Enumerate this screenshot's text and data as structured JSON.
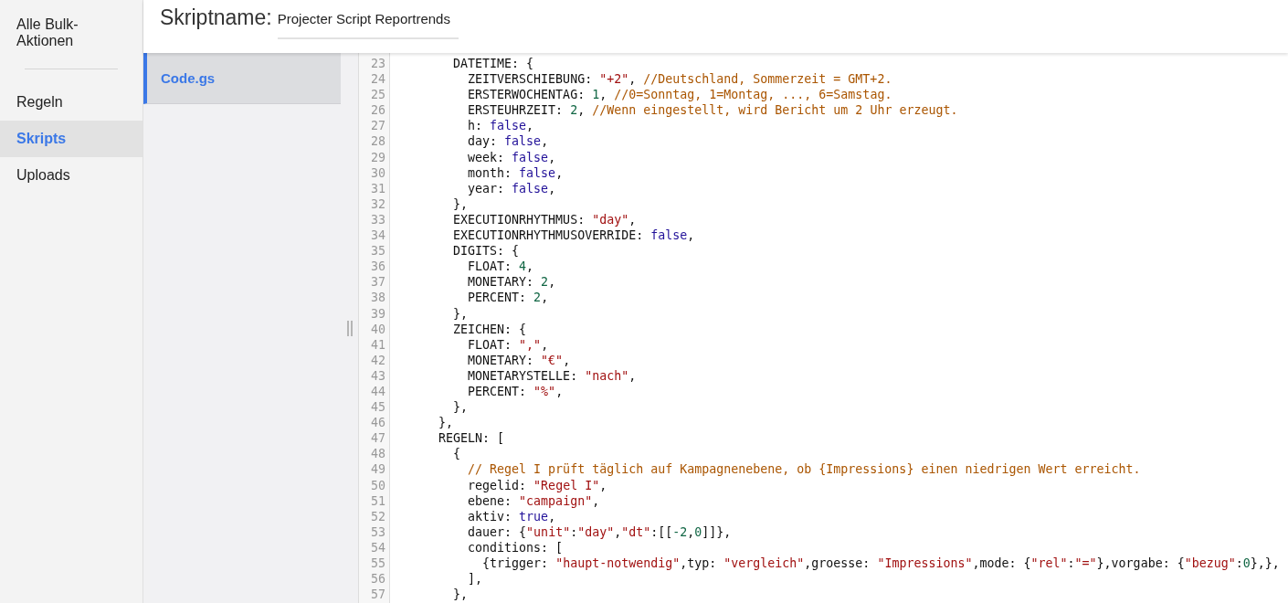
{
  "sidebar": {
    "groups": [
      [
        {
          "label": "Alle Bulk-Aktionen",
          "selected": false
        }
      ],
      [
        {
          "label": "Regeln",
          "selected": false
        },
        {
          "label": "Skripts",
          "selected": true
        },
        {
          "label": "Uploads",
          "selected": false
        }
      ]
    ]
  },
  "header": {
    "label": "Skriptname:",
    "value": "Projecter Script Reportrends"
  },
  "files": [
    {
      "name": "Code.gs",
      "selected": true
    }
  ],
  "editor": {
    "lines": [
      {
        "number": "23",
        "tokens": [
          {
            "kind": "plain",
            "text": "        DATETIME: {"
          }
        ]
      },
      {
        "number": "24",
        "tokens": [
          {
            "kind": "plain",
            "text": "          ZEITVERSCHIEBUNG: "
          },
          {
            "kind": "string",
            "text": "\"+2\""
          },
          {
            "kind": "plain",
            "text": ", "
          },
          {
            "kind": "comment",
            "text": "//Deutschland, Sommerzeit = GMT+2."
          }
        ]
      },
      {
        "number": "25",
        "tokens": [
          {
            "kind": "plain",
            "text": "          ERSTERWOCHENTAG: "
          },
          {
            "kind": "number",
            "text": "1"
          },
          {
            "kind": "plain",
            "text": ", "
          },
          {
            "kind": "comment",
            "text": "//0=Sonntag, 1=Montag, ..., 6=Samstag."
          }
        ]
      },
      {
        "number": "26",
        "tokens": [
          {
            "kind": "plain",
            "text": "          ERSTEUHRZEIT: "
          },
          {
            "kind": "number",
            "text": "2"
          },
          {
            "kind": "plain",
            "text": ", "
          },
          {
            "kind": "comment",
            "text": "//Wenn eingestellt, wird Bericht um 2 Uhr erzeugt."
          }
        ]
      },
      {
        "number": "27",
        "tokens": [
          {
            "kind": "plain",
            "text": "          h: "
          },
          {
            "kind": "keyword",
            "text": "false"
          },
          {
            "kind": "plain",
            "text": ","
          }
        ]
      },
      {
        "number": "28",
        "tokens": [
          {
            "kind": "plain",
            "text": "          day: "
          },
          {
            "kind": "keyword",
            "text": "false"
          },
          {
            "kind": "plain",
            "text": ","
          }
        ]
      },
      {
        "number": "29",
        "tokens": [
          {
            "kind": "plain",
            "text": "          week: "
          },
          {
            "kind": "keyword",
            "text": "false"
          },
          {
            "kind": "plain",
            "text": ","
          }
        ]
      },
      {
        "number": "30",
        "tokens": [
          {
            "kind": "plain",
            "text": "          month: "
          },
          {
            "kind": "keyword",
            "text": "false"
          },
          {
            "kind": "plain",
            "text": ","
          }
        ]
      },
      {
        "number": "31",
        "tokens": [
          {
            "kind": "plain",
            "text": "          year: "
          },
          {
            "kind": "keyword",
            "text": "false"
          },
          {
            "kind": "plain",
            "text": ","
          }
        ]
      },
      {
        "number": "32",
        "tokens": [
          {
            "kind": "plain",
            "text": "        },"
          }
        ]
      },
      {
        "number": "33",
        "tokens": [
          {
            "kind": "plain",
            "text": "        EXECUTIONRHYTHMUS: "
          },
          {
            "kind": "string",
            "text": "\"day\""
          },
          {
            "kind": "plain",
            "text": ","
          }
        ]
      },
      {
        "number": "34",
        "tokens": [
          {
            "kind": "plain",
            "text": "        EXECUTIONRHYTHMUSOVERRIDE: "
          },
          {
            "kind": "keyword",
            "text": "false"
          },
          {
            "kind": "plain",
            "text": ","
          }
        ]
      },
      {
        "number": "35",
        "tokens": [
          {
            "kind": "plain",
            "text": "        DIGITS: {"
          }
        ]
      },
      {
        "number": "36",
        "tokens": [
          {
            "kind": "plain",
            "text": "          FLOAT: "
          },
          {
            "kind": "number",
            "text": "4"
          },
          {
            "kind": "plain",
            "text": ","
          }
        ]
      },
      {
        "number": "37",
        "tokens": [
          {
            "kind": "plain",
            "text": "          MONETARY: "
          },
          {
            "kind": "number",
            "text": "2"
          },
          {
            "kind": "plain",
            "text": ","
          }
        ]
      },
      {
        "number": "38",
        "tokens": [
          {
            "kind": "plain",
            "text": "          PERCENT: "
          },
          {
            "kind": "number",
            "text": "2"
          },
          {
            "kind": "plain",
            "text": ","
          }
        ]
      },
      {
        "number": "39",
        "tokens": [
          {
            "kind": "plain",
            "text": "        },"
          }
        ]
      },
      {
        "number": "40",
        "tokens": [
          {
            "kind": "plain",
            "text": "        ZEICHEN: {"
          }
        ]
      },
      {
        "number": "41",
        "tokens": [
          {
            "kind": "plain",
            "text": "          FLOAT: "
          },
          {
            "kind": "string",
            "text": "\",\""
          },
          {
            "kind": "plain",
            "text": ","
          }
        ]
      },
      {
        "number": "42",
        "tokens": [
          {
            "kind": "plain",
            "text": "          MONETARY: "
          },
          {
            "kind": "string",
            "text": "\"€\""
          },
          {
            "kind": "plain",
            "text": ","
          }
        ]
      },
      {
        "number": "43",
        "tokens": [
          {
            "kind": "plain",
            "text": "          MONETARYSTELLE: "
          },
          {
            "kind": "string",
            "text": "\"nach\""
          },
          {
            "kind": "plain",
            "text": ","
          }
        ]
      },
      {
        "number": "44",
        "tokens": [
          {
            "kind": "plain",
            "text": "          PERCENT: "
          },
          {
            "kind": "string",
            "text": "\"%\""
          },
          {
            "kind": "plain",
            "text": ","
          }
        ]
      },
      {
        "number": "45",
        "tokens": [
          {
            "kind": "plain",
            "text": "        },"
          }
        ]
      },
      {
        "number": "46",
        "tokens": [
          {
            "kind": "plain",
            "text": "      },"
          }
        ]
      },
      {
        "number": "47",
        "tokens": [
          {
            "kind": "plain",
            "text": "      REGELN: ["
          }
        ]
      },
      {
        "number": "48",
        "tokens": [
          {
            "kind": "plain",
            "text": "        {"
          }
        ]
      },
      {
        "number": "49",
        "tokens": [
          {
            "kind": "comment",
            "text": "          // Regel I prüft täglich auf Kampagnenebene, ob {Impressions} einen niedrigen Wert erreicht."
          }
        ]
      },
      {
        "number": "50",
        "tokens": [
          {
            "kind": "plain",
            "text": "          regelid: "
          },
          {
            "kind": "string",
            "text": "\"Regel I\""
          },
          {
            "kind": "plain",
            "text": ","
          }
        ]
      },
      {
        "number": "51",
        "tokens": [
          {
            "kind": "plain",
            "text": "          ebene: "
          },
          {
            "kind": "string",
            "text": "\"campaign\""
          },
          {
            "kind": "plain",
            "text": ","
          }
        ]
      },
      {
        "number": "52",
        "tokens": [
          {
            "kind": "plain",
            "text": "          aktiv: "
          },
          {
            "kind": "keyword",
            "text": "true"
          },
          {
            "kind": "plain",
            "text": ","
          }
        ]
      },
      {
        "number": "53",
        "tokens": [
          {
            "kind": "plain",
            "text": "          dauer: {"
          },
          {
            "kind": "string",
            "text": "\"unit\""
          },
          {
            "kind": "plain",
            "text": ":"
          },
          {
            "kind": "string",
            "text": "\"day\""
          },
          {
            "kind": "plain",
            "text": ","
          },
          {
            "kind": "string",
            "text": "\"dt\""
          },
          {
            "kind": "plain",
            "text": ":[["
          },
          {
            "kind": "number",
            "text": "-2"
          },
          {
            "kind": "plain",
            "text": ","
          },
          {
            "kind": "number",
            "text": "0"
          },
          {
            "kind": "plain",
            "text": "]]},"
          }
        ]
      },
      {
        "number": "54",
        "tokens": [
          {
            "kind": "plain",
            "text": "          conditions: ["
          }
        ]
      },
      {
        "number": "55",
        "tokens": [
          {
            "kind": "plain",
            "text": "            {trigger: "
          },
          {
            "kind": "string",
            "text": "\"haupt-notwendig\""
          },
          {
            "kind": "plain",
            "text": ",typ: "
          },
          {
            "kind": "string",
            "text": "\"vergleich\""
          },
          {
            "kind": "plain",
            "text": ",groesse: "
          },
          {
            "kind": "string",
            "text": "\"Impressions\""
          },
          {
            "kind": "plain",
            "text": ",mode: {"
          },
          {
            "kind": "string",
            "text": "\"rel\""
          },
          {
            "kind": "plain",
            "text": ":"
          },
          {
            "kind": "string",
            "text": "\"=\""
          },
          {
            "kind": "plain",
            "text": "},vorgabe: {"
          },
          {
            "kind": "string",
            "text": "\"bezug\""
          },
          {
            "kind": "plain",
            "text": ":"
          },
          {
            "kind": "number",
            "text": "0"
          },
          {
            "kind": "plain",
            "text": "},},"
          }
        ]
      },
      {
        "number": "56",
        "tokens": [
          {
            "kind": "plain",
            "text": "          ],"
          }
        ]
      },
      {
        "number": "57",
        "tokens": [
          {
            "kind": "plain",
            "text": "        },"
          }
        ]
      }
    ]
  }
}
